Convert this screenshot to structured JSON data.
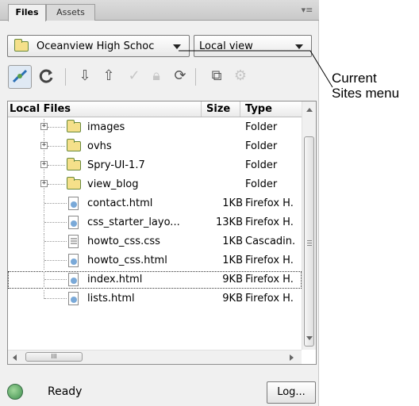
{
  "tabs": [
    "Files",
    "Assets"
  ],
  "site_menu": {
    "value": "Oceanview High Schoc"
  },
  "view_menu": {
    "value": "Local view"
  },
  "toolbar": [
    "connect-icon",
    "refresh-icon",
    "get-files-icon",
    "put-files-icon",
    "check-out-icon",
    "check-in-icon",
    "synchronize-icon",
    "expand-icon",
    "collapse-icon"
  ],
  "columns": {
    "name": "Local Files",
    "size": "Size",
    "type": "Type"
  },
  "files": [
    {
      "name": "images",
      "size": "",
      "type": "Folder",
      "kind": "folder"
    },
    {
      "name": "ovhs",
      "size": "",
      "type": "Folder",
      "kind": "folder"
    },
    {
      "name": "Spry-UI-1.7",
      "size": "",
      "type": "Folder",
      "kind": "folder"
    },
    {
      "name": "view_blog",
      "size": "",
      "type": "Folder",
      "kind": "folder"
    },
    {
      "name": "contact.html",
      "size": "1KB",
      "type": "Firefox H.",
      "kind": "html"
    },
    {
      "name": "css_starter_layo...",
      "size": "13KB",
      "type": "Firefox H.",
      "kind": "html"
    },
    {
      "name": "howto_css.css",
      "size": "1KB",
      "type": "Cascadin.",
      "kind": "css"
    },
    {
      "name": "howto_css.html",
      "size": "1KB",
      "type": "Firefox H.",
      "kind": "html"
    },
    {
      "name": "index.html",
      "size": "9KB",
      "type": "Firefox H.",
      "kind": "html",
      "focused": true
    },
    {
      "name": "lists.html",
      "size": "9KB",
      "type": "Firefox H.",
      "kind": "html"
    }
  ],
  "hscroll_grip": "III",
  "status": {
    "text": "Ready",
    "log_button": "Log..."
  },
  "callout": {
    "line1": "Current",
    "line2": "Sites menu"
  }
}
